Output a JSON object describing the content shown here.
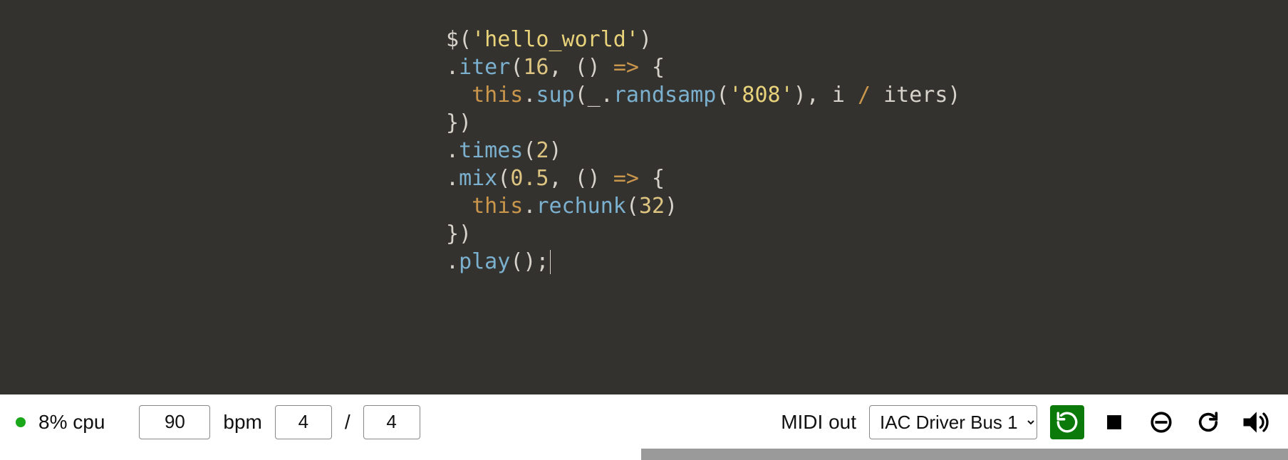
{
  "code": {
    "lines": [
      [
        {
          "t": "$",
          "c": "ident"
        },
        {
          "t": "(",
          "c": "punct"
        },
        {
          "t": "'hello_world'",
          "c": "string"
        },
        {
          "t": ")",
          "c": "punct"
        }
      ],
      [
        {
          "t": ".",
          "c": "punct"
        },
        {
          "t": "iter",
          "c": "method"
        },
        {
          "t": "(",
          "c": "punct"
        },
        {
          "t": "16",
          "c": "number"
        },
        {
          "t": ", () ",
          "c": "default"
        },
        {
          "t": "=>",
          "c": "keyword"
        },
        {
          "t": " {",
          "c": "punct"
        }
      ],
      [
        {
          "t": "  ",
          "c": "default"
        },
        {
          "t": "this",
          "c": "keyword"
        },
        {
          "t": ".",
          "c": "punct"
        },
        {
          "t": "sup",
          "c": "method"
        },
        {
          "t": "(_.",
          "c": "punct"
        },
        {
          "t": "randsamp",
          "c": "method"
        },
        {
          "t": "(",
          "c": "punct"
        },
        {
          "t": "'808'",
          "c": "string"
        },
        {
          "t": "), i ",
          "c": "default"
        },
        {
          "t": "/",
          "c": "keyword"
        },
        {
          "t": " iters)",
          "c": "default"
        }
      ],
      [
        {
          "t": "})",
          "c": "punct"
        }
      ],
      [
        {
          "t": ".",
          "c": "punct"
        },
        {
          "t": "times",
          "c": "method"
        },
        {
          "t": "(",
          "c": "punct"
        },
        {
          "t": "2",
          "c": "number"
        },
        {
          "t": ")",
          "c": "punct"
        }
      ],
      [
        {
          "t": ".",
          "c": "punct"
        },
        {
          "t": "mix",
          "c": "method"
        },
        {
          "t": "(",
          "c": "punct"
        },
        {
          "t": "0.5",
          "c": "number"
        },
        {
          "t": ", () ",
          "c": "default"
        },
        {
          "t": "=>",
          "c": "keyword"
        },
        {
          "t": " {",
          "c": "punct"
        }
      ],
      [
        {
          "t": "  ",
          "c": "default"
        },
        {
          "t": "this",
          "c": "keyword"
        },
        {
          "t": ".",
          "c": "punct"
        },
        {
          "t": "rechunk",
          "c": "method"
        },
        {
          "t": "(",
          "c": "punct"
        },
        {
          "t": "32",
          "c": "number"
        },
        {
          "t": ")",
          "c": "punct"
        }
      ],
      [
        {
          "t": "})",
          "c": "punct"
        }
      ],
      [
        {
          "t": ".",
          "c": "punct"
        },
        {
          "t": "play",
          "c": "method"
        },
        {
          "t": "();",
          "c": "punct"
        }
      ]
    ]
  },
  "status": {
    "cpu_label": "8% cpu",
    "bpm_value": "90",
    "bpm_label": "bpm",
    "beats_num": "4",
    "slash": "/",
    "beats_den": "4",
    "midi_label": "MIDI out",
    "midi_selected": "IAC Driver Bus 1"
  },
  "icons": {
    "reload": "reload-icon",
    "stop": "stop-icon",
    "mute": "mute-circle-icon",
    "loop": "loop-icon",
    "volume": "volume-icon"
  },
  "colors": {
    "editor_bg": "#33322f",
    "accent_green": "#0b7a0b",
    "status_green": "#1aa71a"
  }
}
